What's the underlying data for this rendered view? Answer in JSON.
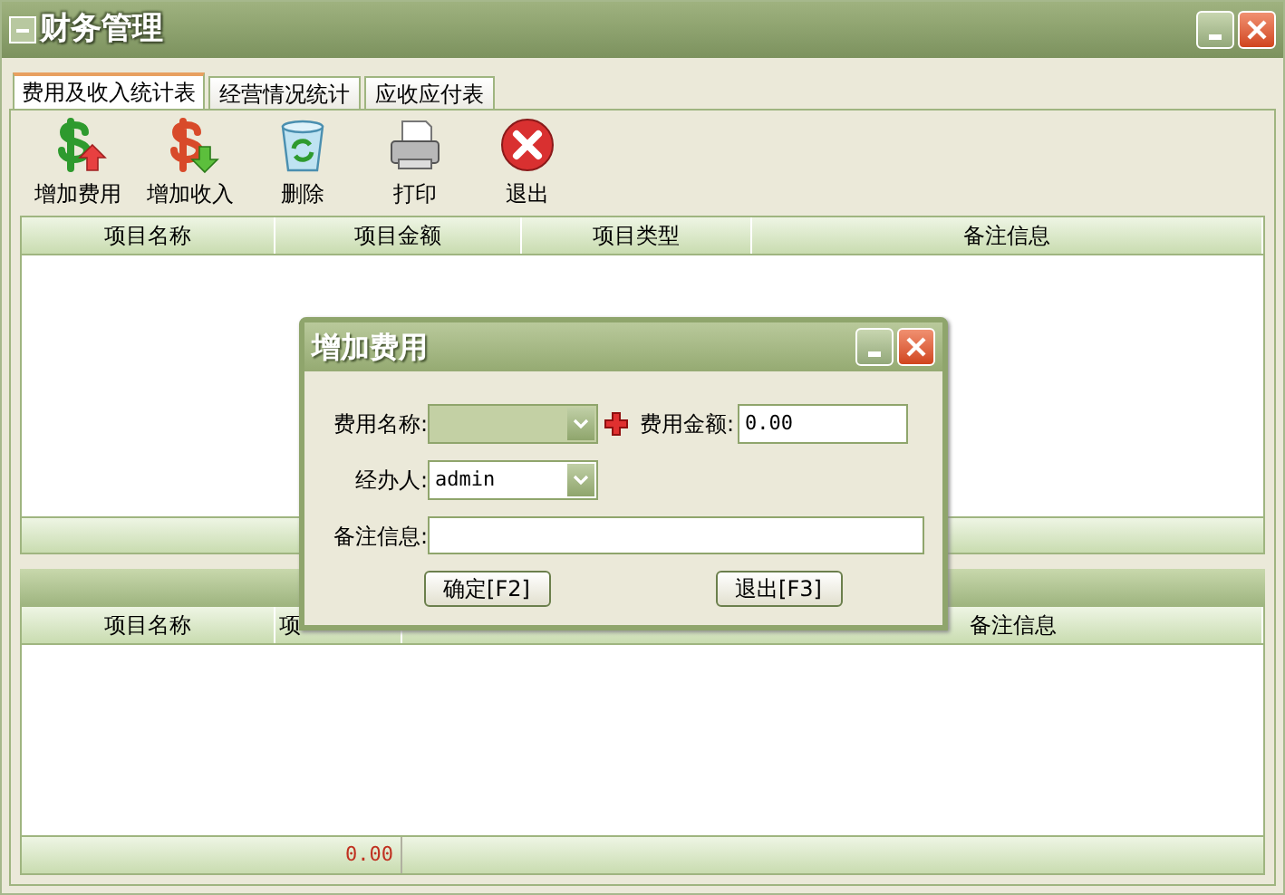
{
  "window": {
    "title": "财务管理"
  },
  "tabs": [
    {
      "label": "费用及收入统计表",
      "selected": true
    },
    {
      "label": "经营情况统计",
      "selected": false
    },
    {
      "label": "应收应付表",
      "selected": false
    }
  ],
  "toolbar": [
    {
      "label": "增加费用",
      "kind": "add-expense"
    },
    {
      "label": "增加收入",
      "kind": "add-income"
    },
    {
      "label": "删除",
      "kind": "delete"
    },
    {
      "label": "打印",
      "kind": "print"
    },
    {
      "label": "退出",
      "kind": "exit"
    }
  ],
  "top_table": {
    "columns": [
      "项目名称",
      "项目金额",
      "项目类型",
      "备注信息"
    ]
  },
  "bottom_table": {
    "columns": [
      "项目名称",
      "项",
      "备注信息"
    ],
    "footer_total": "0.00"
  },
  "dialog": {
    "title": "增加费用",
    "name_label": "费用名称:",
    "amount_label": "费用金额:",
    "amount_value": "0.00",
    "handler_label": "经办人:",
    "handler_value": "admin",
    "remark_label": "备注信息:",
    "buttons": [
      "确定[F2]",
      "退出[F3]"
    ]
  }
}
